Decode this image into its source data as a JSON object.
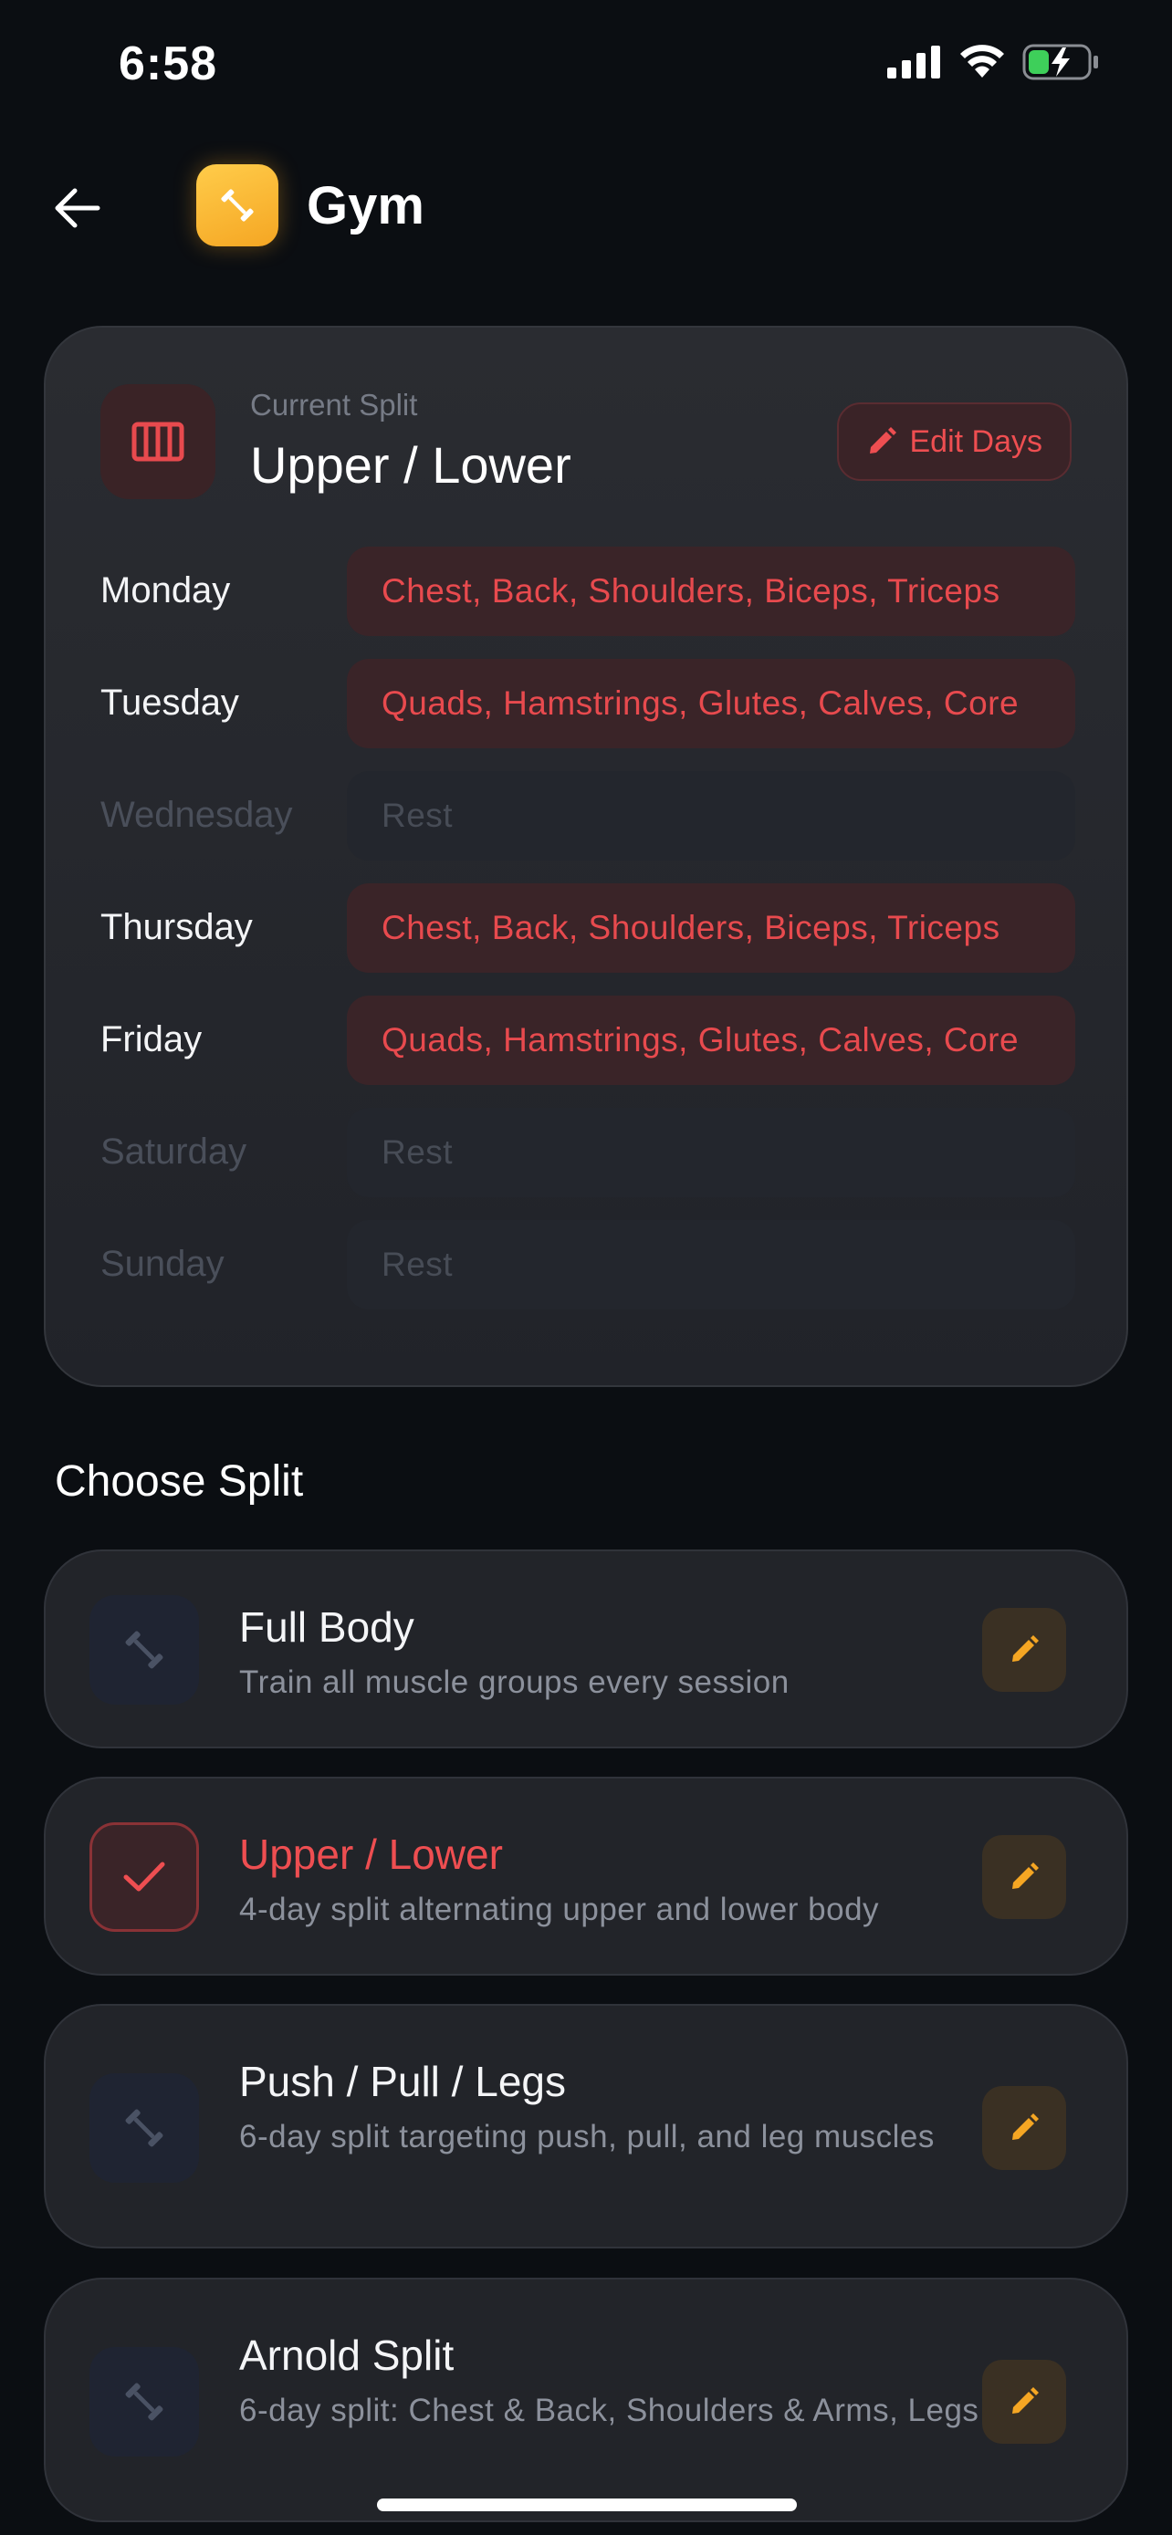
{
  "status_bar": {
    "time": "6:58"
  },
  "header": {
    "title": "Gym"
  },
  "current_split": {
    "label": "Current Split",
    "name": "Upper / Lower",
    "edit_label": "Edit Days",
    "days": [
      {
        "day": "Monday",
        "muscles": "Chest, Back, Shoulders, Biceps, Triceps"
      },
      {
        "day": "Tuesday",
        "muscles": "Quads, Hamstrings, Glutes, Calves, Core"
      },
      {
        "day": "Wednesday",
        "muscles": "Rest"
      },
      {
        "day": "Thursday",
        "muscles": "Chest, Back, Shoulders, Biceps, Triceps"
      },
      {
        "day": "Friday",
        "muscles": "Quads, Hamstrings, Glutes, Calves, Core"
      },
      {
        "day": "Saturday",
        "muscles": "Rest"
      },
      {
        "day": "Sunday",
        "muscles": "Rest"
      }
    ]
  },
  "choose_split": {
    "title": "Choose Split",
    "options": [
      {
        "name": "Full Body",
        "description": "Train all muscle groups every session",
        "selected": false
      },
      {
        "name": "Upper / Lower",
        "description": "4-day split alternating upper and lower body",
        "selected": true
      },
      {
        "name": "Push / Pull / Legs",
        "description": "6-day split targeting push, pull, and leg muscles",
        "selected": false
      },
      {
        "name": "Arnold Split",
        "description": "6-day split: Chest & Back, Shoulders & Arms, Legs",
        "selected": false
      }
    ]
  },
  "colors": {
    "accent_red": "#ee4e51",
    "accent_amber": "#f5a623",
    "background": "#0b0e12"
  }
}
